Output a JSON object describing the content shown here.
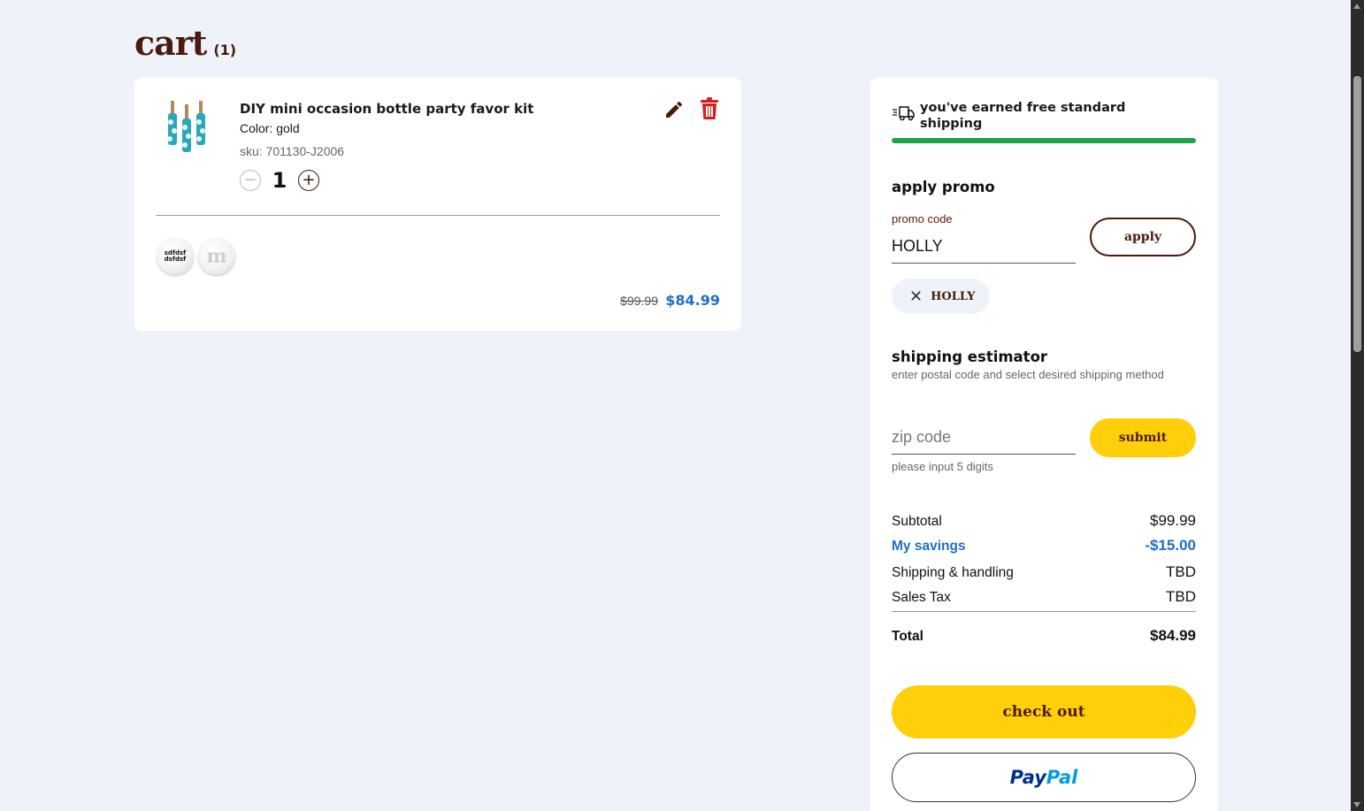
{
  "page": {
    "title": "cart",
    "count": "(1)"
  },
  "cart_item": {
    "name": "DIY mini occasion bottle party favor kit",
    "color": "Color: gold",
    "sku": "sku: 701130-J2006",
    "quantity": "1",
    "candy_1_text": "sdfdsf dsfdsf",
    "candy_2_text": "m",
    "price_original": "$99.99",
    "price_sale": "$84.99",
    "icons": {
      "edit": "pencil-icon",
      "delete": "trash-icon",
      "decrease": "minus-icon",
      "increase": "plus-icon"
    }
  },
  "summary": {
    "shipping_message": "you've earned free standard shipping",
    "shipping_progress": 1.0,
    "promo": {
      "heading": "apply promo",
      "label": "promo code",
      "value": "HOLLY",
      "apply_label": "apply",
      "applied_code": "HOLLY"
    },
    "estimator": {
      "heading": "shipping estimator",
      "subtext": "enter postal code and select desired shipping method",
      "zip_placeholder": "zip code",
      "submit_label": "submit",
      "hint": "please input 5 digits"
    },
    "totals": {
      "subtotal_label": "Subtotal",
      "subtotal_value": "$99.99",
      "savings_label": "My savings",
      "savings_value": "-$15.00",
      "shipping_label": "Shipping & handling",
      "shipping_value": "TBD",
      "tax_label": "Sales Tax",
      "tax_value": "TBD",
      "total_label": "Total",
      "total_value": "$84.99"
    },
    "checkout_label": "check out",
    "paypal": {
      "pay": "Pay",
      "pal": "Pal"
    }
  },
  "colors": {
    "brand_brown": "#4a1a0c",
    "brand_yellow": "#ffcf0a",
    "savings_blue": "#1f6fc5",
    "progress_green": "#1ea44a",
    "page_bg": "#eef3fa"
  }
}
